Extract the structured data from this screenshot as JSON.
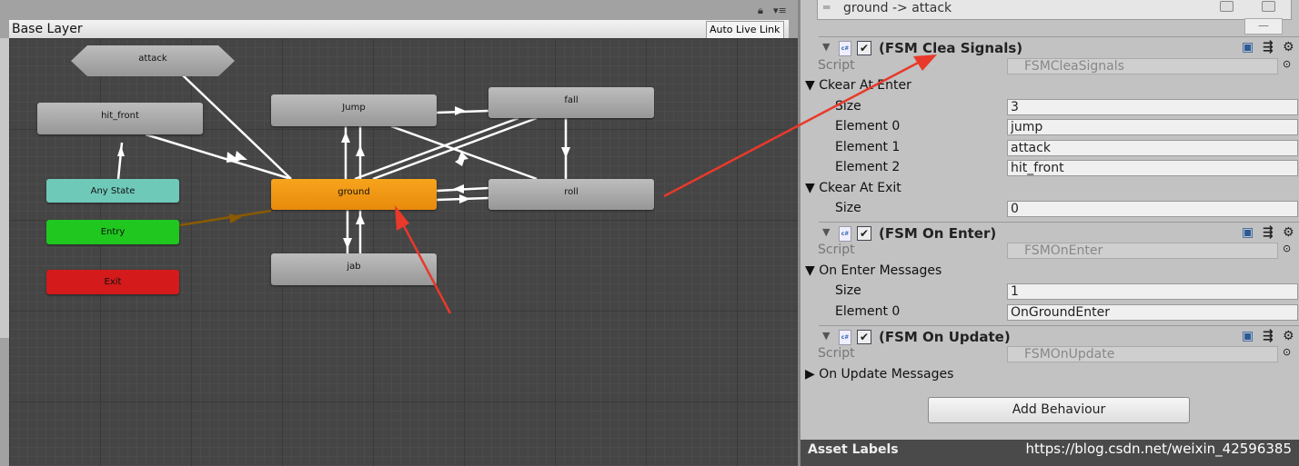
{
  "toolbar": {
    "breadcrumb": "Base Layer",
    "auto_live_link": "Auto Live Link"
  },
  "nodes": {
    "attack": "attack",
    "hit_front": "hit_front",
    "any_state": "Any State",
    "entry": "Entry",
    "exit": "Exit",
    "jump": "Jump",
    "fall": "fall",
    "ground": "ground",
    "roll": "roll",
    "jab": "jab"
  },
  "node_colors": {
    "default": "#a8a8a8",
    "any_state": "#6fc9b9",
    "entry": "#1fc71f",
    "exit": "#d41a1a",
    "ground": "#f39c12",
    "annotation_arrow": "#e8392b"
  },
  "inspector": {
    "transition": "ground -> attack",
    "components": [
      {
        "title": "(FSM Clea Signals)",
        "script_label": "Script",
        "script": "FSMCleaSignals",
        "list_label": "Ckear At Enter",
        "size_label": "Size",
        "size": "3",
        "elements": [
          {
            "label": "Element 0",
            "value": "jump"
          },
          {
            "label": "Element 1",
            "value": "attack"
          },
          {
            "label": "Element 2",
            "value": "hit_front"
          }
        ],
        "list2_label": "Ckear At Exit",
        "size2": "0"
      },
      {
        "title": "(FSM On Enter)",
        "script_label": "Script",
        "script": "FSMOnEnter",
        "list_label": "On Enter Messages",
        "size_label": "Size",
        "size": "1",
        "elements": [
          {
            "label": "Element 0",
            "value": "OnGroundEnter"
          }
        ]
      },
      {
        "title": "(FSM On Update)",
        "script_label": "Script",
        "script": "FSMOnUpdate",
        "list_label": "On Update Messages"
      }
    ],
    "add_behaviour": "Add Behaviour",
    "asset_labels": "Asset Labels",
    "watermark": "https://blog.csdn.net/weixin_42596385"
  }
}
